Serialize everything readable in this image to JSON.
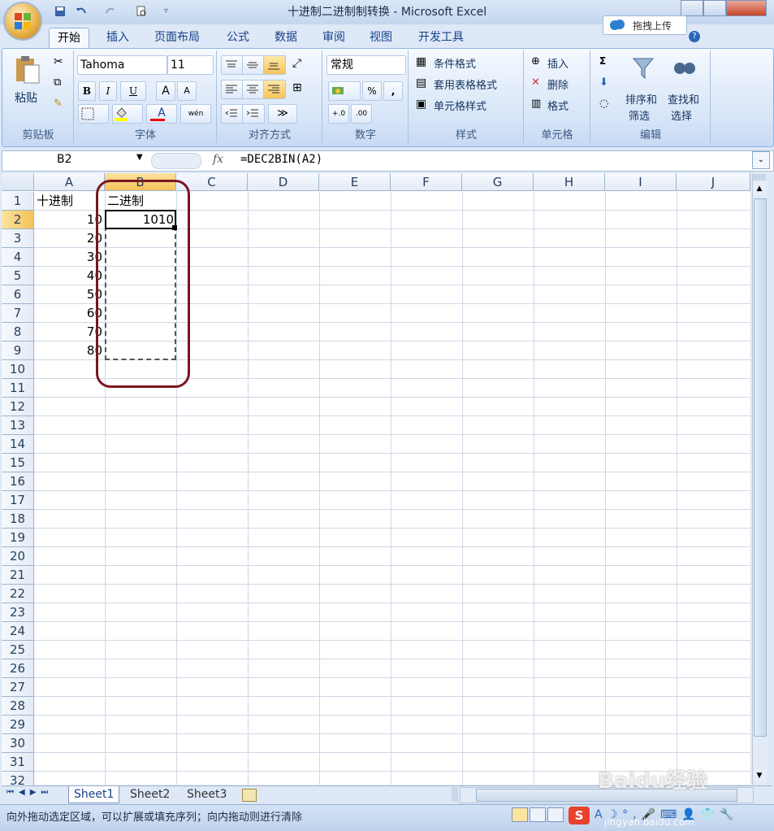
{
  "window": {
    "title": "十进制二进制制转换 - Microsoft Excel"
  },
  "upload": {
    "label": "拖拽上传"
  },
  "tabs": [
    "开始",
    "插入",
    "页面布局",
    "公式",
    "数据",
    "审阅",
    "视图",
    "开发工具"
  ],
  "ribbon": {
    "clipboard": {
      "paste": "粘贴",
      "label": "剪贴板"
    },
    "font": {
      "name": "Tahoma",
      "size": "11",
      "label": "字体",
      "bold": "B",
      "italic": "I",
      "underline": "U",
      "grow": "A",
      "shrink": "A",
      "font_color": "A",
      "phonetic": "wén"
    },
    "alignment": {
      "label": "对齐方式"
    },
    "number": {
      "format": "常规",
      "label": "数字",
      "percent": "%",
      "comma": ","
    },
    "styles": {
      "conditional": "条件格式",
      "table": "套用表格格式",
      "cell": "单元格样式",
      "label": "样式"
    },
    "cells": {
      "insert": "插入",
      "delete": "删除",
      "format": "格式",
      "label": "单元格"
    },
    "editing": {
      "sort": "排序和",
      "sort2": "筛选",
      "find": "查找和",
      "find2": "选择",
      "label": "编辑",
      "sigma": "Σ"
    }
  },
  "formula_bar": {
    "name_box": "B2",
    "fx": "fx",
    "formula": "=DEC2BIN(A2)"
  },
  "columns": [
    "A",
    "B",
    "C",
    "D",
    "E",
    "F",
    "G",
    "H",
    "I",
    "J"
  ],
  "rows": [
    "1",
    "2",
    "3",
    "4",
    "5",
    "6",
    "7",
    "8",
    "9",
    "10",
    "11",
    "12",
    "13",
    "14",
    "15",
    "16",
    "17",
    "18",
    "19",
    "20",
    "21",
    "22",
    "23",
    "24",
    "25",
    "26",
    "27",
    "28",
    "29",
    "30",
    "31",
    "32"
  ],
  "cells": {
    "A1": "十进制",
    "B1": "二进制",
    "A2": "10",
    "B2": "1010",
    "A3": "20",
    "A4": "30",
    "A5": "40",
    "A6": "50",
    "A7": "60",
    "A8": "70",
    "A9": "80"
  },
  "sheets": [
    "Sheet1",
    "Sheet2",
    "Sheet3"
  ],
  "status": {
    "text": "向外拖动选定区域，可以扩展或填充序列；向内拖动则进行清除"
  },
  "watermark": {
    "text": "Baidu经验",
    "url": "jingyan.baidu.com"
  },
  "colors": {
    "accent": "#15428b",
    "selected_header": "#f5c15a",
    "oval": "#7a1622"
  }
}
